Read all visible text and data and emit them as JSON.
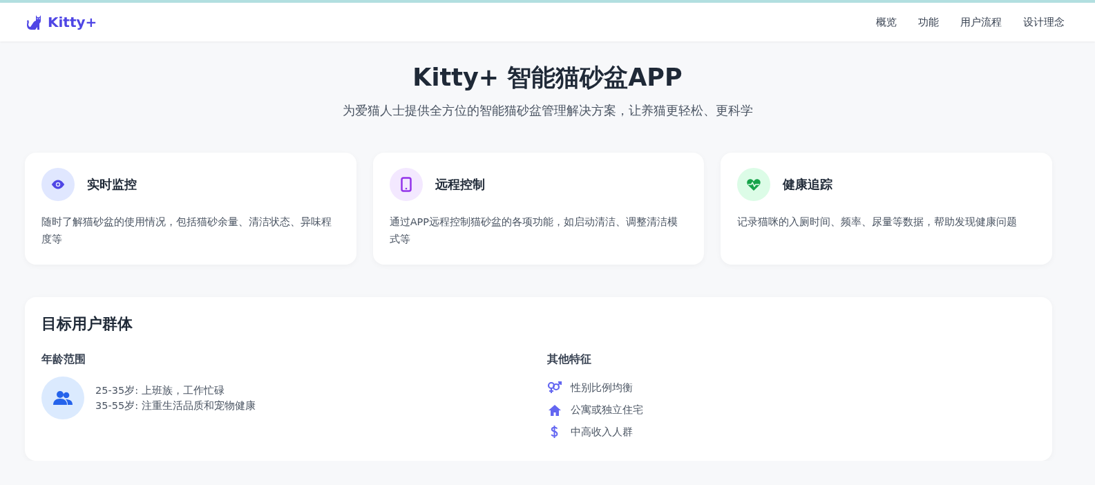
{
  "brand": {
    "name": "Kitty+"
  },
  "nav": [
    {
      "label": "概览"
    },
    {
      "label": "功能"
    },
    {
      "label": "用户流程"
    },
    {
      "label": "设计理念"
    }
  ],
  "hero": {
    "title": "Kitty+ 智能猫砂盆APP",
    "subtitle": "为爱猫人士提供全方位的智能猫砂盆管理解决方案，让养猫更轻松、更科学"
  },
  "features": [
    {
      "kind": "eye",
      "title": "实时监控",
      "text": "随时了解猫砂盆的使用情况，包括猫砂余量、清洁状态、异味程度等"
    },
    {
      "kind": "phone",
      "title": "远程控制",
      "text": "通过APP远程控制猫砂盆的各项功能，如启动清洁、调整清洁模式等"
    },
    {
      "kind": "heart",
      "title": "健康追踪",
      "text": "记录猫咪的入厕时间、频率、尿量等数据，帮助发现健康问题"
    }
  ],
  "audience": {
    "title": "目标用户群体",
    "age": {
      "heading": "年龄范围",
      "lines": [
        "25-35岁: 上班族，工作忙碌",
        "35-55岁: 注重生活品质和宠物健康"
      ]
    },
    "traits": {
      "heading": "其他特征",
      "items": [
        {
          "kind": "gender",
          "label": "性别比例均衡"
        },
        {
          "kind": "home",
          "label": "公寓或独立住宅"
        },
        {
          "kind": "money",
          "label": "中高收入人群"
        }
      ]
    }
  }
}
